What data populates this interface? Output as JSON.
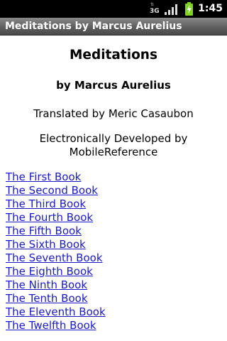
{
  "status_bar": {
    "network_label": "3G",
    "time": "1:45",
    "icons": [
      "data-arrows-icon",
      "signal-strength-icon",
      "battery-charging-icon"
    ],
    "colors": {
      "background": "#000000",
      "text": "#ffffff",
      "battery": "#7ed321"
    }
  },
  "app_bar": {
    "title": "Meditations by Marcus Aurelius"
  },
  "page": {
    "title": "Meditations",
    "author": "by Marcus Aurelius",
    "translator": "Translated by Meric Casaubon",
    "publisher": "Electronically Developed by MobileReference"
  },
  "toc": {
    "items": [
      {
        "label": "The First Book"
      },
      {
        "label": "The Second Book"
      },
      {
        "label": "The Third Book"
      },
      {
        "label": "The Fourth Book"
      },
      {
        "label": "The Fifth Book"
      },
      {
        "label": "The Sixth Book"
      },
      {
        "label": "The Seventh Book"
      },
      {
        "label": "The Eighth Book"
      },
      {
        "label": "The Ninth Book"
      },
      {
        "label": "The Tenth Book"
      },
      {
        "label": "The Eleventh Book"
      },
      {
        "label": "The Twelfth Book"
      }
    ],
    "link_color": "#1a1ac8"
  }
}
